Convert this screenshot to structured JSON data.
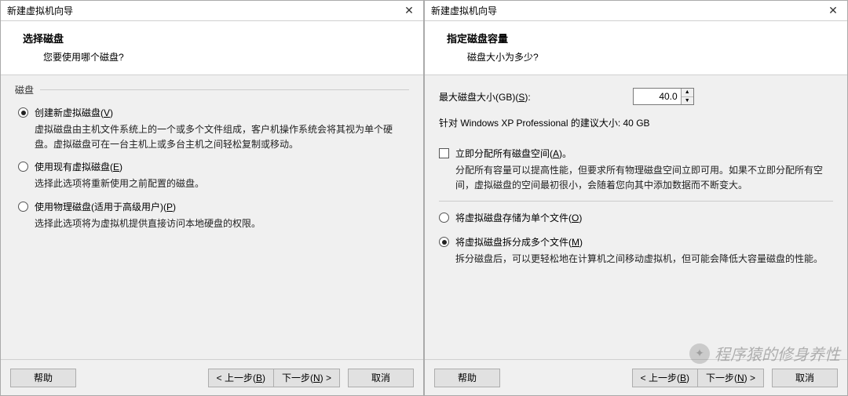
{
  "left": {
    "window_title": "新建虚拟机向导",
    "header_title": "选择磁盘",
    "header_sub": "您要使用哪个磁盘?",
    "fieldset_label": "磁盘",
    "opt1_label": "创建新虚拟磁盘(V)",
    "opt1_desc": "虚拟磁盘由主机文件系统上的一个或多个文件组成，客户机操作系统会将其视为单个硬盘。虚拟磁盘可在一台主机上或多台主机之间轻松复制或移动。",
    "opt2_label": "使用现有虚拟磁盘(E)",
    "opt2_desc": "选择此选项将重新使用之前配置的磁盘。",
    "opt3_label": "使用物理磁盘(适用于高级用户)(P)",
    "opt3_desc": "选择此选项将为虚拟机提供直接访问本地硬盘的权限。",
    "btn_help": "帮助",
    "btn_back": "< 上一步(B)",
    "btn_next": "下一步(N) >",
    "btn_cancel": "取消"
  },
  "right": {
    "window_title": "新建虚拟机向导",
    "header_title": "指定磁盘容量",
    "header_sub": "磁盘大小为多少?",
    "size_label": "最大磁盘大小(GB)(S):",
    "size_value": "40.0",
    "recommend_text": "针对 Windows XP Professional 的建议大小: 40 GB",
    "check_label": "立即分配所有磁盘空间(A)。",
    "check_desc": "分配所有容量可以提高性能，但要求所有物理磁盘空间立即可用。如果不立即分配所有空间，虚拟磁盘的空间最初很小，会随着您向其中添加数据而不断变大。",
    "optA_label": "将虚拟磁盘存储为单个文件(O)",
    "optB_label": "将虚拟磁盘拆分成多个文件(M)",
    "optB_desc": "拆分磁盘后，可以更轻松地在计算机之间移动虚拟机，但可能会降低大容量磁盘的性能。",
    "btn_help": "帮助",
    "btn_back": "< 上一步(B)",
    "btn_next": "下一步(N) >",
    "btn_cancel": "取消"
  },
  "watermark": "程序猿的修身养性"
}
